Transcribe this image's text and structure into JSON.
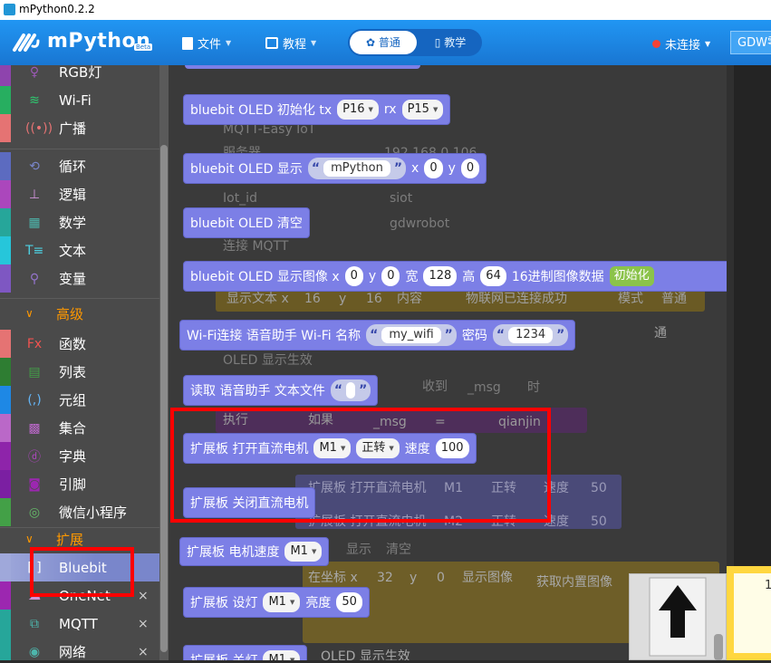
{
  "app": {
    "title": "mPython0.2.2",
    "brand": "mPython",
    "beta": "Beta"
  },
  "topbar": {
    "file_label": "文件",
    "tutorial_label": "教程",
    "mode_normal": "普通",
    "mode_teach": "教学",
    "status": "未连接",
    "device": "GDW零"
  },
  "colors": {
    "accent": "#1e88e5",
    "block": "#7c7fe6",
    "highlight": "#ff0000"
  },
  "sidebar": {
    "items": [
      {
        "label": "RGB灯",
        "icon": "bulb-icon"
      },
      {
        "label": "Wi-Fi",
        "icon": "wifi-icon"
      },
      {
        "label": "广播",
        "icon": "broadcast-icon"
      },
      {
        "label": "循环",
        "icon": "loop-icon"
      },
      {
        "label": "逻辑",
        "icon": "logic-icon"
      },
      {
        "label": "数学",
        "icon": "calculator-icon"
      },
      {
        "label": "文本",
        "icon": "text-icon"
      },
      {
        "label": "变量",
        "icon": "variable-icon"
      }
    ],
    "section_advanced": "高级",
    "adv_items": [
      {
        "label": "函数",
        "icon": "function-icon"
      },
      {
        "label": "列表",
        "icon": "list-icon"
      },
      {
        "label": "元组",
        "icon": "tuple-icon"
      },
      {
        "label": "集合",
        "icon": "set-icon"
      },
      {
        "label": "字典",
        "icon": "dict-icon"
      },
      {
        "label": "引脚",
        "icon": "pin-icon"
      },
      {
        "label": "微信小程序",
        "icon": "wechat-icon"
      }
    ],
    "section_ext": "扩展",
    "ext_items": [
      {
        "label": "Bluebit",
        "icon": "bluebit-icon"
      },
      {
        "label": "OneNet",
        "icon": "cloud-icon"
      },
      {
        "label": "MQTT",
        "icon": "mqtt-icon"
      },
      {
        "label": "网络",
        "icon": "network-icon"
      }
    ],
    "close_glyph": "×"
  },
  "ghost": {
    "g1": "MQTT-Easy IoT",
    "g2": "服务器",
    "g3": "192.168.0.106",
    "g4": "Iot_id",
    "g5": "siot",
    "g6": "gdwrobot",
    "g7": "连接 MQTT",
    "g8": "显示文本 x",
    "g9": "16",
    "g10": "y",
    "g11": "16",
    "g12": "内容",
    "g13": "物联网已连接成功",
    "g14": "模式",
    "g15": "普通",
    "g16": "OLED 显示生效",
    "g17": "收到",
    "g18": "_msg",
    "g19": "时",
    "g20": "执行",
    "g21": "如果",
    "g22": "_msg",
    "g23": "=",
    "g24": "qianjin",
    "g25": "扩展板 打开直流电机",
    "g26": "M1",
    "g27": "正转",
    "g28": "速度",
    "g29": "50",
    "g30": "扩展板 打开直流电机",
    "g31": "M2",
    "g32": "正转",
    "g33": "速度",
    "g34": "50",
    "g35": "显示",
    "g36": "清空",
    "g37": "在坐标 x",
    "g38": "32",
    "g39": "y",
    "g40": "0",
    "g41": "显示图像",
    "g42": "获取内置图像",
    "g43": "OLED 显示生效",
    "g44": "通",
    "g45": "1"
  },
  "blocks": {
    "b1": {
      "text": "bluebit OLED 初始化 tx",
      "tx": "P16",
      "rx_label": "rx",
      "rx": "P15"
    },
    "b2": {
      "text": "bluebit OLED 显示",
      "str": "mPython",
      "x_label": "x",
      "x": "0",
      "y_label": "y",
      "y": "0"
    },
    "b3": {
      "text": "bluebit OLED 清空"
    },
    "b4": {
      "text": "bluebit OLED 显示图像 x",
      "x": "0",
      "y_label": "y",
      "y": "0",
      "w_label": "宽",
      "w": "128",
      "h_label": "高",
      "h": "64",
      "hex_label": "16进制图像数据",
      "init": "初始化"
    },
    "b5": {
      "text": "Wi-Fi连接 语音助手 Wi-Fi 名称",
      "ssid": "my_wifi",
      "pwd_label": "密码",
      "pwd": "1234"
    },
    "b6": {
      "text": "读取 语音助手 文本文件"
    },
    "b7": {
      "text": "扩展板 打开直流电机",
      "motor": "M1",
      "dir": "正转",
      "speed_label": "速度",
      "speed": "100"
    },
    "b8": {
      "text": "扩展板 关闭直流电机"
    },
    "b9": {
      "text": "扩展板 电机速度",
      "motor": "M1"
    },
    "b10": {
      "text": "扩展板 设灯",
      "light": "M1",
      "bright_label": "亮度",
      "bright": "50"
    },
    "b11": {
      "text": "扩展板 关灯",
      "light": "M1"
    }
  },
  "quote": "“",
  "quote_close": "”"
}
